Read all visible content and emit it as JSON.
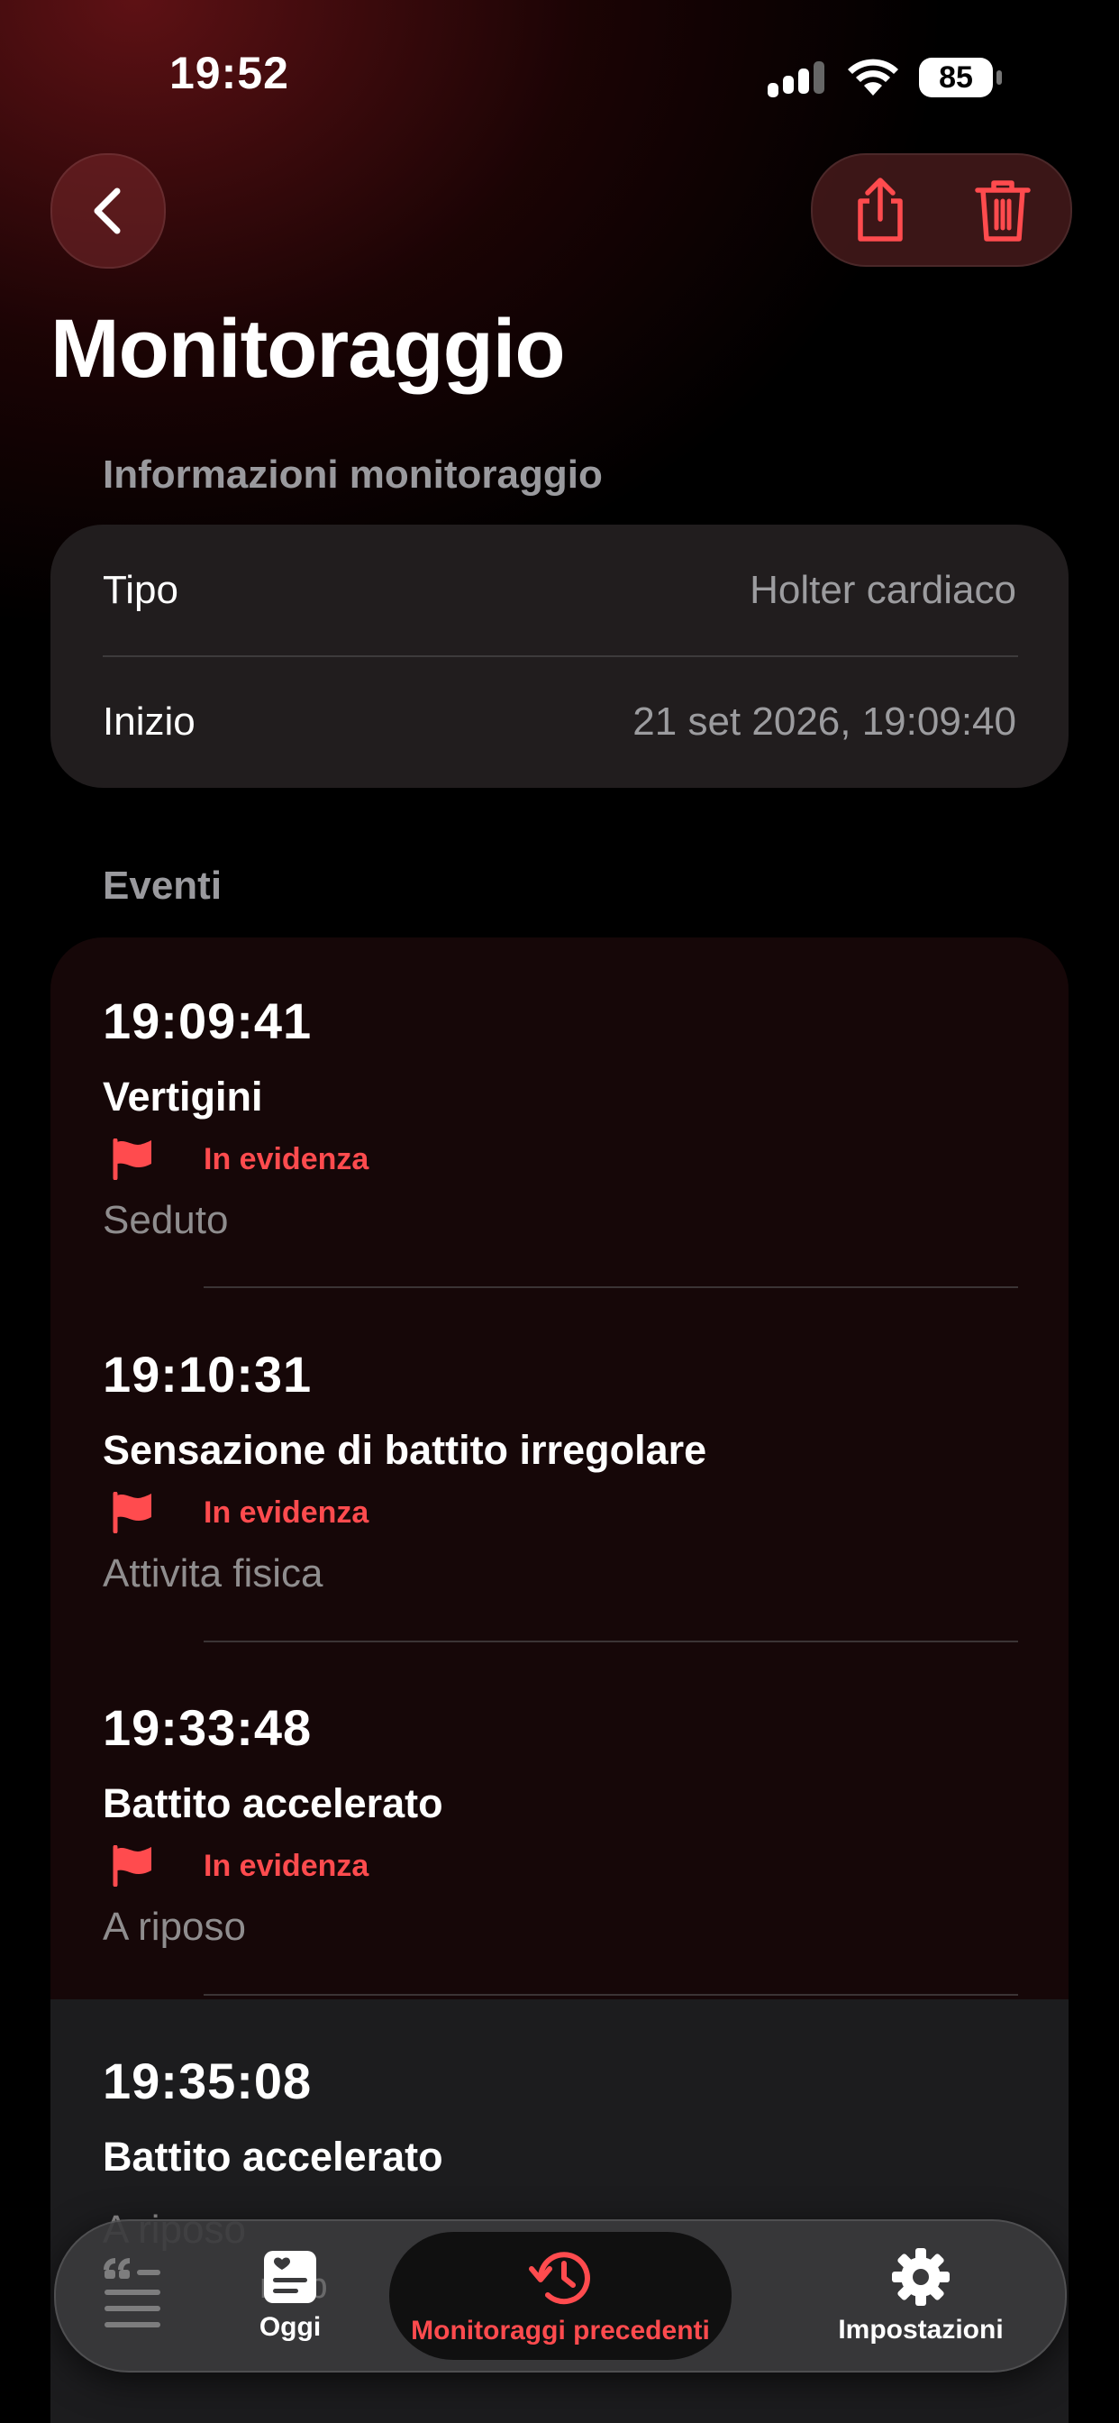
{
  "status_bar": {
    "time": "19:52",
    "battery": "85"
  },
  "colors": {
    "accent": "#ff4b4e",
    "background": "#000000",
    "card": "#242021",
    "secondary_text": "#9c9c9f"
  },
  "header": {
    "back_icon": "chevron-left-icon",
    "share_icon": "share-icon",
    "trash_icon": "trash-icon",
    "title": "Monitoraggio"
  },
  "info": {
    "section_title": "Informazioni monitoraggio",
    "rows": [
      {
        "label": "Tipo",
        "value": "Holter cardiaco"
      },
      {
        "label": "Inizio",
        "value": "21 set 2026, 19:09:40"
      }
    ]
  },
  "events": {
    "section_title": "Eventi",
    "items": [
      {
        "time": "19:09:41",
        "title": "Vertigini",
        "flag": "In evidenza",
        "position": "Seduto"
      },
      {
        "time": "19:10:31",
        "title": "Sensazione di battito irregolare",
        "flag": "In evidenza",
        "position": "Attivita fisica"
      },
      {
        "time": "19:33:48",
        "title": "Battito accelerato",
        "flag": "In evidenza",
        "position": "A riposo"
      },
      {
        "time": "19:35:08",
        "title": "Battito accelerato",
        "flag": "",
        "position": "A riposo"
      }
    ]
  },
  "tabbar": {
    "tabs": [
      {
        "label": "Oggi",
        "icon": "heart-note-icon",
        "active": false
      },
      {
        "label": "Monitoraggi precedenti",
        "icon": "history-icon",
        "active": true
      },
      {
        "label": "Impostazioni",
        "icon": "gear-icon",
        "active": false
      }
    ],
    "ghost_text": "msb"
  }
}
